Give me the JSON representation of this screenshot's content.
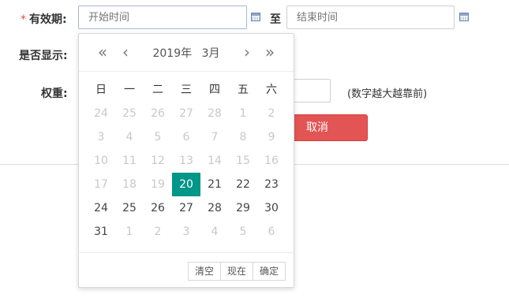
{
  "form": {
    "required_mark": "*",
    "validity_label": "有效期:",
    "start_placeholder": "开始时间",
    "to_label": "至",
    "end_placeholder": "结束时间",
    "display_label": "是否显示:",
    "weight_label": "权重:",
    "weight_value": "",
    "weight_hint": "(数字越大越靠前)",
    "cancel_label": "取消"
  },
  "datepicker": {
    "year_label": "2019年",
    "month_label": "3月",
    "nav": {
      "prev_year": "«",
      "prev_month": "‹",
      "next_month": "›",
      "next_year": "»"
    },
    "weekdays": [
      "日",
      "一",
      "二",
      "三",
      "四",
      "五",
      "六"
    ],
    "selected_day": "20",
    "weeks": [
      [
        {
          "d": "24",
          "o": true
        },
        {
          "d": "25",
          "o": true
        },
        {
          "d": "26",
          "o": true
        },
        {
          "d": "27",
          "o": true
        },
        {
          "d": "28",
          "o": true
        },
        {
          "d": "1",
          "o": true
        },
        {
          "d": "2",
          "o": true
        }
      ],
      [
        {
          "d": "3",
          "o": true
        },
        {
          "d": "4",
          "o": true
        },
        {
          "d": "5",
          "o": true
        },
        {
          "d": "6",
          "o": true
        },
        {
          "d": "7",
          "o": true
        },
        {
          "d": "8",
          "o": true
        },
        {
          "d": "9",
          "o": true
        }
      ],
      [
        {
          "d": "10",
          "o": true
        },
        {
          "d": "11",
          "o": true
        },
        {
          "d": "12",
          "o": true
        },
        {
          "d": "13",
          "o": true
        },
        {
          "d": "14",
          "o": true
        },
        {
          "d": "15",
          "o": true
        },
        {
          "d": "16",
          "o": true
        }
      ],
      [
        {
          "d": "17",
          "o": true
        },
        {
          "d": "18",
          "o": true
        },
        {
          "d": "19",
          "o": true
        },
        {
          "d": "20",
          "o": false
        },
        {
          "d": "21",
          "o": false
        },
        {
          "d": "22",
          "o": false
        },
        {
          "d": "23",
          "o": false
        }
      ],
      [
        {
          "d": "24",
          "o": false
        },
        {
          "d": "25",
          "o": false
        },
        {
          "d": "26",
          "o": false
        },
        {
          "d": "27",
          "o": false
        },
        {
          "d": "28",
          "o": false
        },
        {
          "d": "29",
          "o": false
        },
        {
          "d": "30",
          "o": false
        }
      ],
      [
        {
          "d": "31",
          "o": false
        },
        {
          "d": "1",
          "o": true
        },
        {
          "d": "2",
          "o": true
        },
        {
          "d": "3",
          "o": true
        },
        {
          "d": "4",
          "o": true
        },
        {
          "d": "5",
          "o": true
        },
        {
          "d": "6",
          "o": true
        }
      ]
    ],
    "footer": {
      "clear": "清空",
      "now": "现在",
      "confirm": "确定"
    }
  },
  "colors": {
    "selected_bg": "#009688",
    "cancel_bg": "#e25554",
    "required": "#e84c3d"
  },
  "icons": {
    "start_calendar": "calendar-icon",
    "end_calendar": "calendar-icon"
  }
}
